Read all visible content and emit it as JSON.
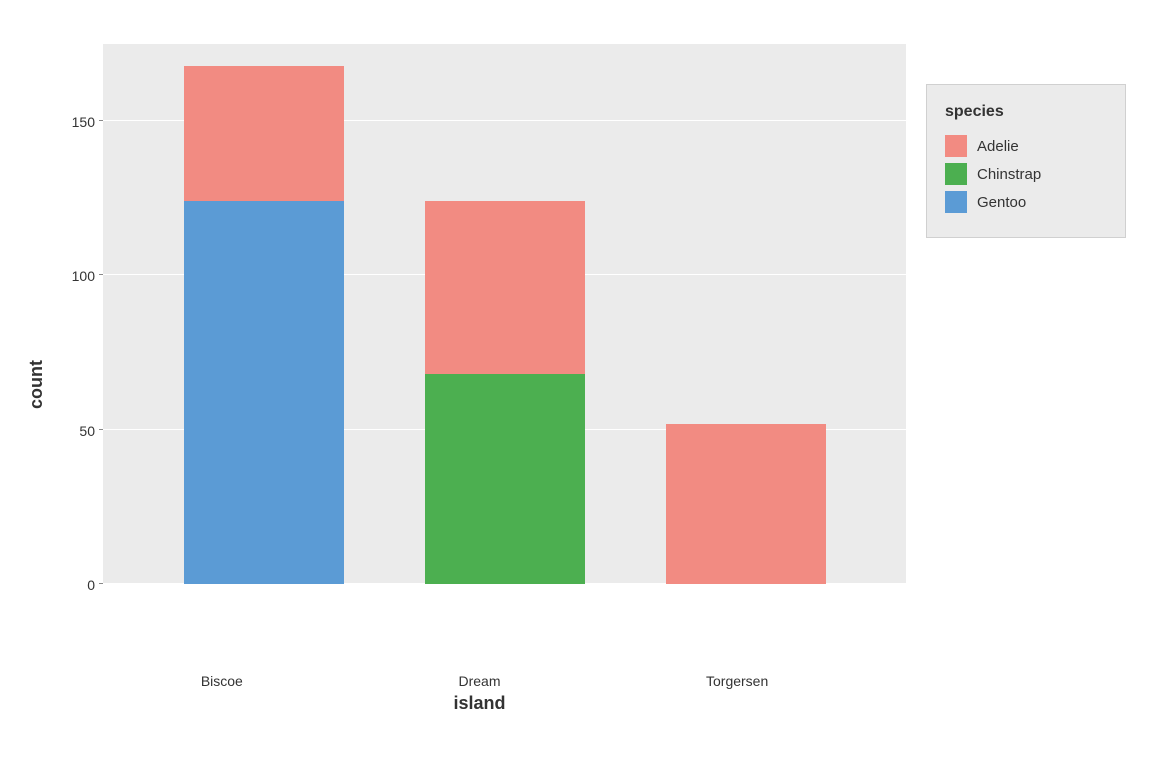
{
  "chart": {
    "title": "",
    "y_axis_label": "count",
    "x_axis_label": "island",
    "y_ticks": [
      {
        "value": 0,
        "label": "0"
      },
      {
        "value": 50,
        "label": "50"
      },
      {
        "value": 100,
        "label": "100"
      },
      {
        "value": 150,
        "label": "150"
      }
    ],
    "x_ticks": [
      "Biscoe",
      "Dream",
      "Torgersen"
    ],
    "max_value": 175,
    "bars": [
      {
        "island": "Biscoe",
        "segments": [
          {
            "species": "Gentoo",
            "count": 124,
            "color": "#5b9bd5"
          },
          {
            "species": "Adelie",
            "count": 44,
            "color": "#f28b82"
          }
        ]
      },
      {
        "island": "Dream",
        "segments": [
          {
            "species": "Chinstrap",
            "count": 68,
            "color": "#4caf50"
          },
          {
            "species": "Adelie",
            "count": 56,
            "color": "#f28b82"
          }
        ]
      },
      {
        "island": "Torgersen",
        "segments": [
          {
            "species": "Adelie",
            "count": 52,
            "color": "#f28b82"
          }
        ]
      }
    ],
    "legend": {
      "title": "species",
      "items": [
        {
          "label": "Adelie",
          "color": "#f28b82"
        },
        {
          "label": "Chinstrap",
          "color": "#4caf50"
        },
        {
          "label": "Gentoo",
          "color": "#5b9bd5"
        }
      ]
    }
  }
}
